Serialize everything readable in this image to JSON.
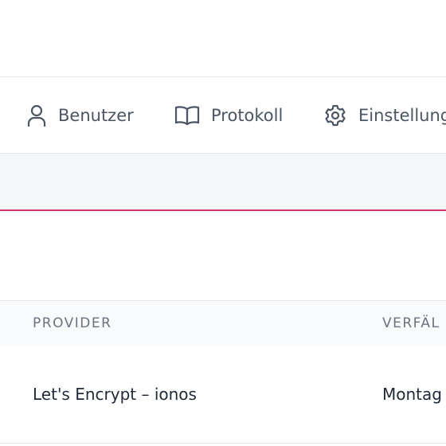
{
  "nav": {
    "items": [
      {
        "label": "Benutzer",
        "icon": "user-icon"
      },
      {
        "label": "Protokoll",
        "icon": "book-open-icon"
      },
      {
        "label": "Einstellung",
        "icon": "gear-icon"
      }
    ]
  },
  "table": {
    "columns": [
      "PROVIDER",
      "VERFÄL"
    ],
    "rows": [
      {
        "provider": "Let's Encrypt – ionos",
        "expiry": "Montag"
      }
    ]
  },
  "colors": {
    "accent": "#d5336a",
    "border": "#e5e7eb",
    "subbar_bg": "#f5f6f8",
    "header_bg": "#f9fafb"
  }
}
